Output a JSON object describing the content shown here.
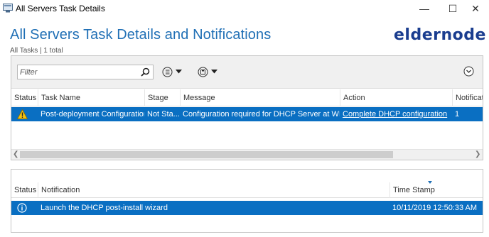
{
  "window": {
    "title": "All Servers Task Details",
    "minimize_glyph": "—",
    "maximize_glyph": "☐",
    "close_glyph": "✕"
  },
  "header": {
    "title": "All Servers Task Details and Notifications",
    "subtitle": "All Tasks | 1 total"
  },
  "logo": {
    "text": "eldernode",
    "icon": "play-arrows-icon",
    "color": "#1a3d8f",
    "accent": "#2bb3e6"
  },
  "tasks": {
    "filter_placeholder": "Filter",
    "columns": [
      "Status",
      "Task Name",
      "Stage",
      "Message",
      "Action",
      "Notificat"
    ],
    "rows": [
      {
        "status_icon": "warning-icon",
        "task_name": "Post-deployment Configuration",
        "stage": "Not Sta...",
        "message": "Configuration required for DHCP Server at WIN...",
        "action": "Complete DHCP configuration",
        "notifications": "1"
      }
    ]
  },
  "notifications": {
    "columns": [
      "Status",
      "Notification",
      "Time Stamp"
    ],
    "rows": [
      {
        "status_icon": "info-icon",
        "notification": "Launch the DHCP post-install wizard",
        "time_stamp": "10/11/2019 12:50:33 AM"
      }
    ]
  },
  "colors": {
    "title_blue": "#1f6fb5",
    "selection_blue": "#0a6fc2"
  }
}
